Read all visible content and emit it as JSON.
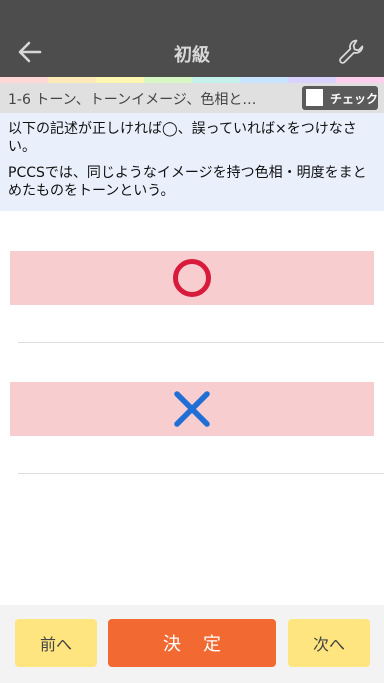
{
  "header": {
    "title": "初級"
  },
  "colors": {
    "header_bg": "#4d4d4d",
    "answer_bg": "#f8cdd0",
    "circle": "#d81b3a",
    "cross": "#1f6fd6",
    "decide_button": "#f26a32",
    "nav_button": "#ffe57f",
    "stripe": [
      "#ffd7d7",
      "#ffe9b8",
      "#fff7b0",
      "#d9f7c4",
      "#c4f1e9",
      "#c8e3ff",
      "#dcd2ff",
      "#ffd0ec"
    ]
  },
  "topic": {
    "text": "1-6 トーン、トーンイメージ、色相と…",
    "check_label": "チェック"
  },
  "question": {
    "instruction": "以下の記述が正しければ◯、誤っていれば×をつけなさい。",
    "statement": "PCCSでは、同じようなイメージを持つ色相・明度をまとめたものをトーンという。"
  },
  "answers": [
    {
      "icon": "circle-icon"
    },
    {
      "icon": "cross-icon"
    }
  ],
  "footer": {
    "prev_label": "前へ",
    "decide_label": "決定",
    "next_label": "次へ"
  }
}
